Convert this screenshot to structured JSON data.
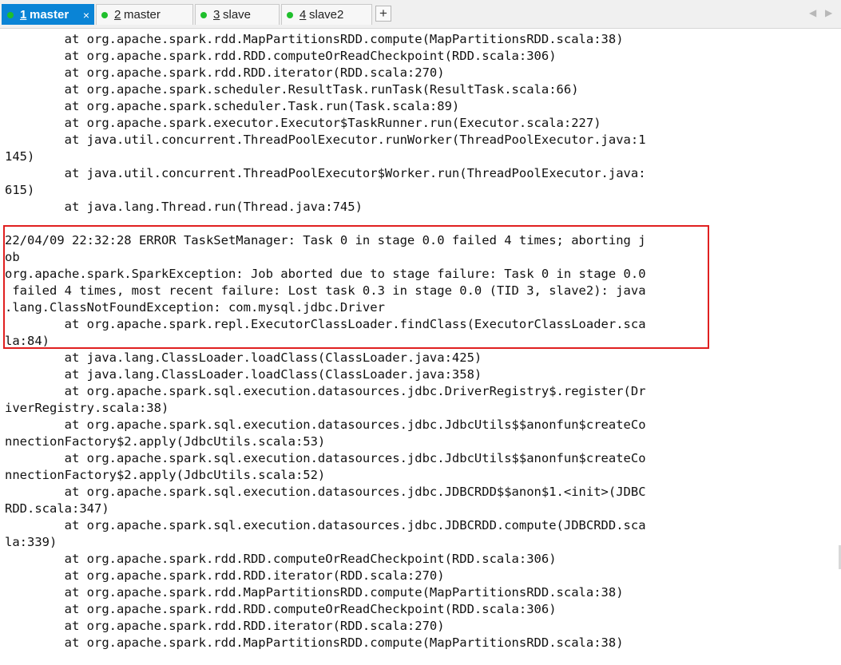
{
  "tabs": [
    {
      "num": "1",
      "name": "master",
      "active": true
    },
    {
      "num": "2",
      "name": "master",
      "active": false
    },
    {
      "num": "3",
      "name": "slave",
      "active": false
    },
    {
      "num": "4",
      "name": "slave2",
      "active": false
    }
  ],
  "tab_close_glyph": "×",
  "add_tab_glyph": "+",
  "nav_prev_glyph": "◀",
  "nav_next_glyph": "▶",
  "colors": {
    "active_tab": "#0a84d6",
    "status_dot": "#1fbf2c",
    "highlight_border": "#e02020"
  },
  "terminal_lines": [
    "        at org.apache.spark.rdd.MapPartitionsRDD.compute(MapPartitionsRDD.scala:38)",
    "        at org.apache.spark.rdd.RDD.computeOrReadCheckpoint(RDD.scala:306)",
    "        at org.apache.spark.rdd.RDD.iterator(RDD.scala:270)",
    "        at org.apache.spark.scheduler.ResultTask.runTask(ResultTask.scala:66)",
    "        at org.apache.spark.scheduler.Task.run(Task.scala:89)",
    "        at org.apache.spark.executor.Executor$TaskRunner.run(Executor.scala:227)",
    "        at java.util.concurrent.ThreadPoolExecutor.runWorker(ThreadPoolExecutor.java:1",
    "145)",
    "        at java.util.concurrent.ThreadPoolExecutor$Worker.run(ThreadPoolExecutor.java:",
    "615)",
    "        at java.lang.Thread.run(Thread.java:745)",
    "",
    "22/04/09 22:32:28 ERROR TaskSetManager: Task 0 in stage 0.0 failed 4 times; aborting j",
    "ob",
    "org.apache.spark.SparkException: Job aborted due to stage failure: Task 0 in stage 0.0",
    " failed 4 times, most recent failure: Lost task 0.3 in stage 0.0 (TID 3, slave2): java",
    ".lang.ClassNotFoundException: com.mysql.jdbc.Driver",
    "        at org.apache.spark.repl.ExecutorClassLoader.findClass(ExecutorClassLoader.sca",
    "la:84)",
    "        at java.lang.ClassLoader.loadClass(ClassLoader.java:425)",
    "        at java.lang.ClassLoader.loadClass(ClassLoader.java:358)",
    "        at org.apache.spark.sql.execution.datasources.jdbc.DriverRegistry$.register(Dr",
    "iverRegistry.scala:38)",
    "        at org.apache.spark.sql.execution.datasources.jdbc.JdbcUtils$$anonfun$createCo",
    "nnectionFactory$2.apply(JdbcUtils.scala:53)",
    "        at org.apache.spark.sql.execution.datasources.jdbc.JdbcUtils$$anonfun$createCo",
    "nnectionFactory$2.apply(JdbcUtils.scala:52)",
    "        at org.apache.spark.sql.execution.datasources.jdbc.JDBCRDD$$anon$1.<init>(JDBC",
    "RDD.scala:347)",
    "        at org.apache.spark.sql.execution.datasources.jdbc.JDBCRDD.compute(JDBCRDD.sca",
    "la:339)",
    "        at org.apache.spark.rdd.RDD.computeOrReadCheckpoint(RDD.scala:306)",
    "        at org.apache.spark.rdd.RDD.iterator(RDD.scala:270)",
    "        at org.apache.spark.rdd.MapPartitionsRDD.compute(MapPartitionsRDD.scala:38)",
    "        at org.apache.spark.rdd.RDD.computeOrReadCheckpoint(RDD.scala:306)",
    "        at org.apache.spark.rdd.RDD.iterator(RDD.scala:270)",
    "        at org.apache.spark.rdd.MapPartitionsRDD.compute(MapPartitionsRDD.scala:38)"
  ]
}
